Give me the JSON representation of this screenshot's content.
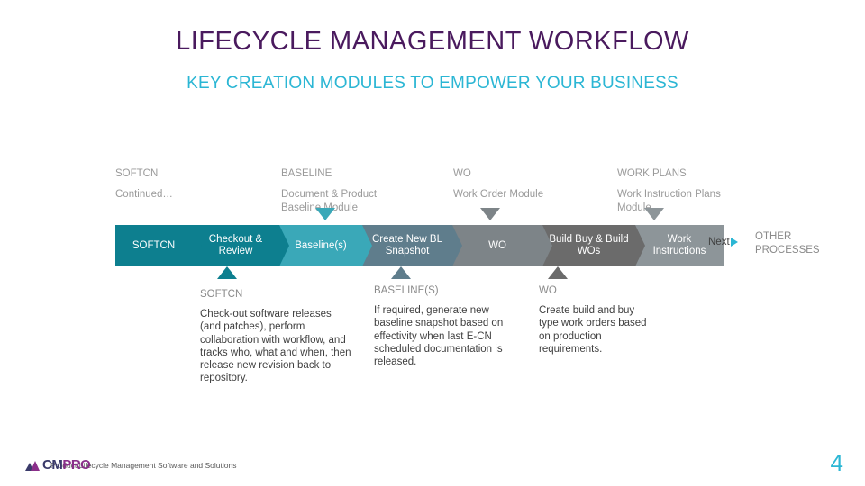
{
  "title": "LIFECYCLE MANAGEMENT WORKFLOW",
  "subtitle": "KEY CREATION MODULES TO EMPOWER YOUR BUSINESS",
  "colors": {
    "title": "#4a1a5e",
    "subtitle": "#2bb6d4",
    "teal_dark": "#0d7f8f",
    "teal_mid": "#3aa8b8",
    "blue_gray": "#5f7d8c",
    "gray": "#7d8488",
    "gray_dark": "#6b6b6b",
    "gray_light": "#9a9a9a",
    "accent": "#2bb6d4"
  },
  "column_headers": [
    {
      "title": "SOFTCN",
      "sub": "Continued…"
    },
    {
      "title": "BASELINE",
      "sub": "Document & Product Baseline Module"
    },
    {
      "title": "WO",
      "sub": "Work Order Module"
    },
    {
      "title": "WORK PLANS",
      "sub": "Work Instruction Plans Module"
    }
  ],
  "chevrons": [
    {
      "label": "SOFTCN"
    },
    {
      "label": "Checkout & Review"
    },
    {
      "label": "Baseline(s)"
    },
    {
      "label": "Create New BL Snapshot"
    },
    {
      "label": "WO"
    },
    {
      "label": "Build Buy & Build WOs"
    },
    {
      "label": "Work Instructions"
    }
  ],
  "next": {
    "label": "Next",
    "other": "OTHER PROCESSES"
  },
  "notes": [
    {
      "title": "SOFTCN",
      "body": "Check-out software releases (and patches), perform collaboration with workflow, and tracks who, what and when, then release new revision back to repository."
    },
    {
      "title": "BASELINE(S)",
      "body": "If required, generate new baseline snapshot based on effectivity when last E-CN scheduled documentation is released."
    },
    {
      "title": "WO",
      "body": "Create build and buy type work orders based on production requirements."
    }
  ],
  "footer": {
    "logo_cm": "CM",
    "logo_pro": "PRO",
    "tagline": "Product Lifecycle Management Software and Solutions",
    "page_number": "4"
  }
}
